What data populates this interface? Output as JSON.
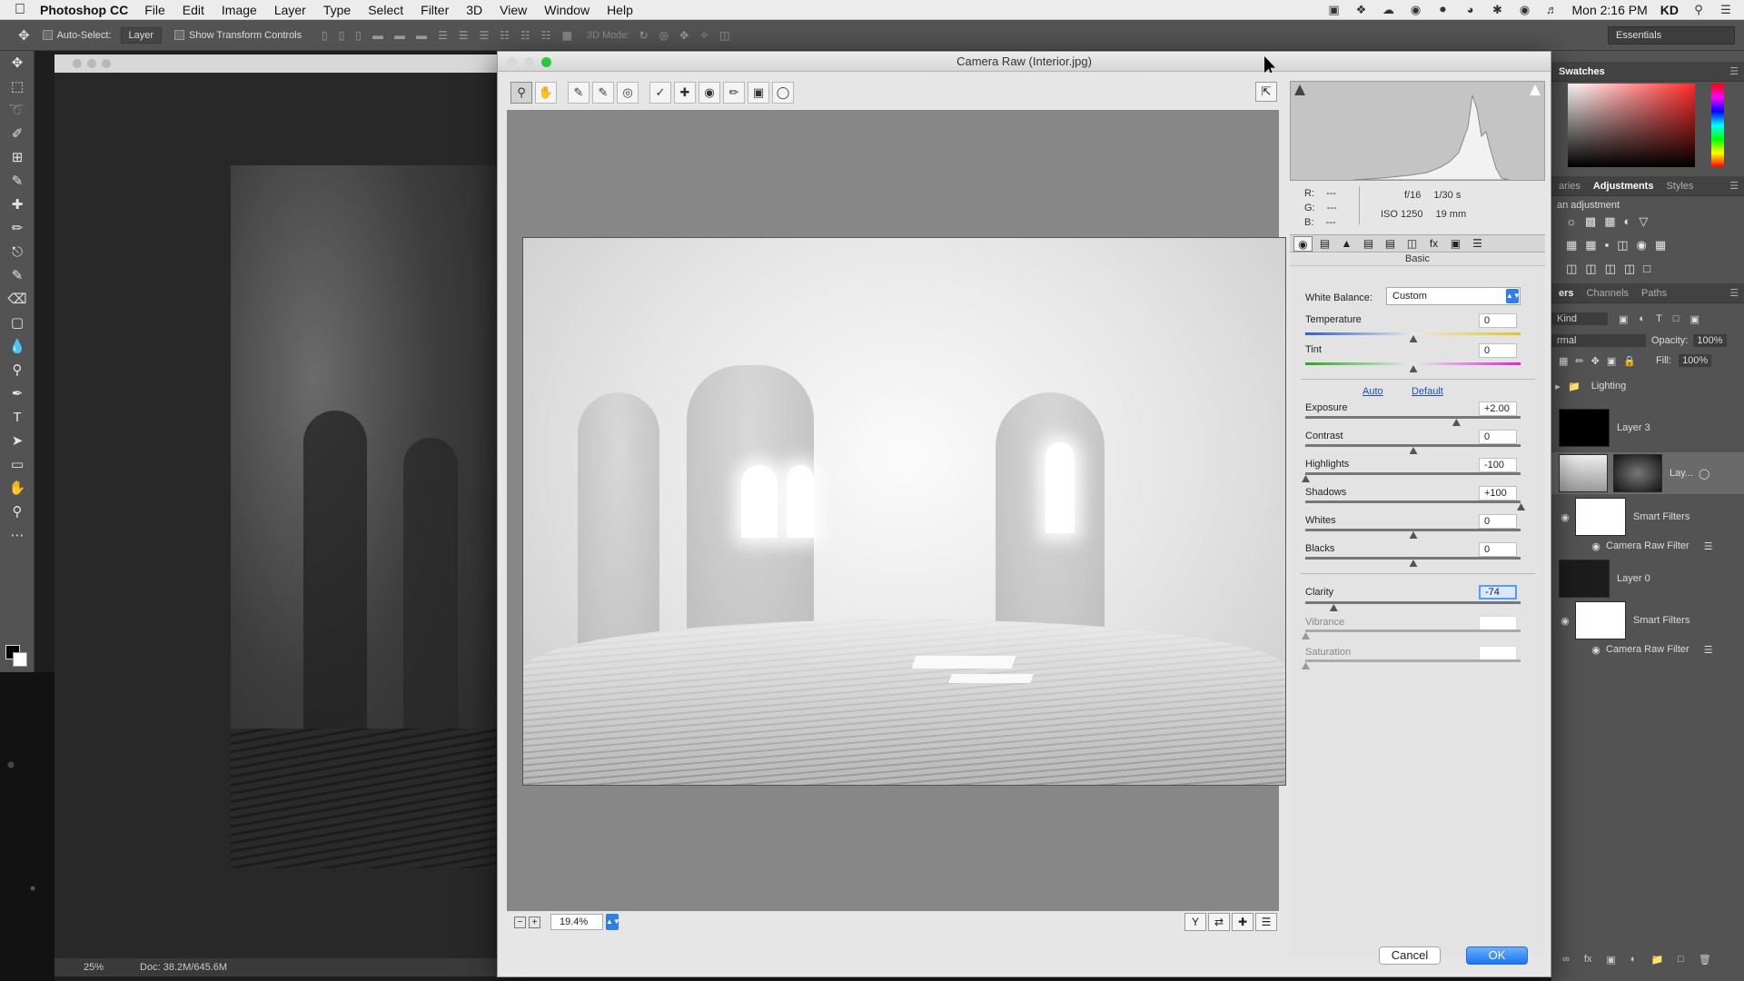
{
  "menubar": {
    "app_name": "Photoshop CC",
    "items": [
      "File",
      "Edit",
      "Image",
      "Layer",
      "Type",
      "Select",
      "Filter",
      "3D",
      "View",
      "Window",
      "Help"
    ],
    "clock": "Mon 2:16 PM",
    "user": "KD",
    "status_icons": [
      "camera-icon",
      "dropbox-icon",
      "cloud-icon",
      "chrome-icon",
      "creative-cloud-icon",
      "eye-icon",
      "bluetooth-icon",
      "wifi-icon",
      "volume-icon",
      "search-icon",
      "list-icon"
    ]
  },
  "options_bar": {
    "auto_select_label": "Auto-Select:",
    "auto_select_value": "Layer",
    "show_transform_label": "Show Transform Controls",
    "mode_3d_label": "3D Mode:",
    "workspace": "Essentials"
  },
  "document": {
    "zoom": "25%",
    "doc_info": "Doc: 38.2M/645.6M"
  },
  "right_panels": {
    "swatches_tab": "Swatches",
    "tabs_adjust": [
      "aries",
      "Adjustments",
      "Styles"
    ],
    "adjust_hint": "an adjustment",
    "tabs_layers": [
      "ers",
      "Channels",
      "Paths"
    ],
    "kind_label": "Kind",
    "blend_mode": "rmal",
    "opacity_label": "Opacity:",
    "opacity_value": "100%",
    "fill_label": "Fill:",
    "fill_value": "100%",
    "layers": [
      {
        "name": "Lighting"
      },
      {
        "name": "Layer 3"
      },
      {
        "name": "Lay..."
      },
      {
        "name": "Smart Filters"
      },
      {
        "name": "Camera Raw Filter"
      },
      {
        "name": "Layer 0"
      },
      {
        "name": "Smart Filters"
      },
      {
        "name": "Camera Raw Filter"
      }
    ]
  },
  "camera_raw": {
    "title": "Camera Raw (Interior.jpg)",
    "exif": {
      "aperture": "f/16",
      "shutter": "1/30 s",
      "iso": "ISO 1250",
      "focal": "19 mm",
      "r": "R:",
      "g": "G:",
      "b": "B:",
      "r_val": "---",
      "g_val": "---",
      "b_val": "---"
    },
    "panel_title": "Basic",
    "white_balance_label": "White Balance:",
    "white_balance_value": "Custom",
    "auto_link": "Auto",
    "default_link": "Default",
    "sliders": [
      {
        "label": "Temperature",
        "value": "0",
        "level": 0.5
      },
      {
        "label": "Tint",
        "value": "0",
        "level": 0.5
      },
      {
        "label": "Exposure",
        "value": "+2.00",
        "level": 0.7
      },
      {
        "label": "Contrast",
        "value": "0",
        "level": 0.5
      },
      {
        "label": "Highlights",
        "value": "-100",
        "level": 0.0
      },
      {
        "label": "Shadows",
        "value": "+100",
        "level": 1.0
      },
      {
        "label": "Whites",
        "value": "0",
        "level": 0.5
      },
      {
        "label": "Blacks",
        "value": "0",
        "level": 0.5
      },
      {
        "label": "Clarity",
        "value": "-74",
        "level": 0.13
      },
      {
        "label": "Vibrance",
        "value": "",
        "level": 0.0
      },
      {
        "label": "Saturation",
        "value": "",
        "level": 0.0
      }
    ],
    "zoom_value": "19.4%",
    "cancel_label": "Cancel",
    "ok_label": "OK"
  }
}
